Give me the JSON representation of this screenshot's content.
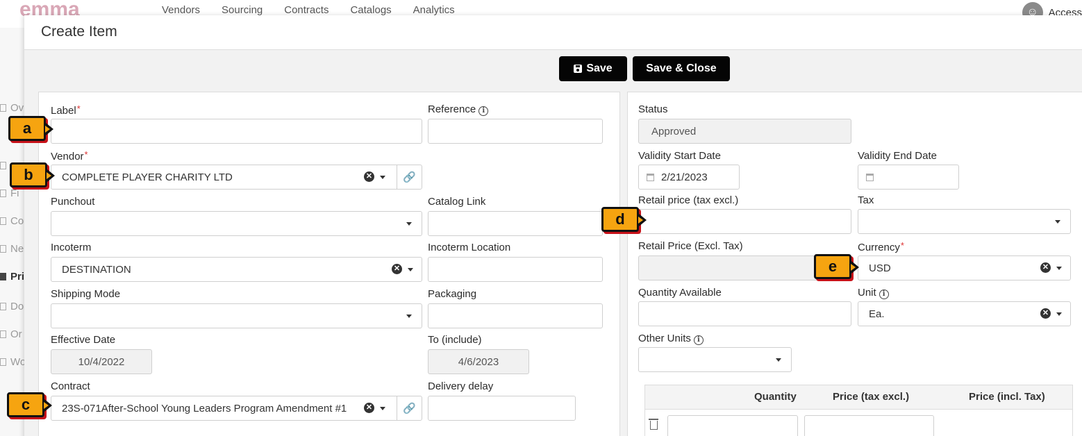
{
  "app": {
    "logo_text": "emma",
    "nav": [
      "Vendors",
      "Sourcing",
      "Contracts",
      "Catalogs",
      "Analytics"
    ],
    "access_label": "Access",
    "sidebar": [
      {
        "label": "Ov",
        "active": false
      },
      {
        "label": "",
        "active": false
      },
      {
        "label": "Fi",
        "active": false
      },
      {
        "label": "Co",
        "active": false
      },
      {
        "label": "Ne",
        "active": false
      },
      {
        "label": "Pri",
        "active": true
      },
      {
        "label": "Do",
        "active": false
      },
      {
        "label": "Or",
        "active": false
      },
      {
        "label": "Wo",
        "active": false
      }
    ]
  },
  "modal": {
    "title": "Create Item",
    "toolbar": {
      "save": "Save",
      "save_close": "Save & Close"
    }
  },
  "left": {
    "label": {
      "label": "Label",
      "value": ""
    },
    "reference": {
      "label": "Reference",
      "value": ""
    },
    "vendor": {
      "label": "Vendor",
      "value": "COMPLETE PLAYER CHARITY LTD"
    },
    "punchout": {
      "label": "Punchout",
      "value": ""
    },
    "catalog_link": {
      "label": "Catalog Link",
      "value": ""
    },
    "incoterm": {
      "label": "Incoterm",
      "value": "DESTINATION"
    },
    "incoterm_location": {
      "label": "Incoterm Location",
      "value": ""
    },
    "shipping_mode": {
      "label": "Shipping Mode",
      "value": ""
    },
    "packaging": {
      "label": "Packaging",
      "value": ""
    },
    "effective_date": {
      "label": "Effective Date",
      "value": "10/4/2022"
    },
    "to_include": {
      "label": "To (include)",
      "value": "4/6/2023"
    },
    "contract": {
      "label": "Contract",
      "value": "23S-071After-School Young Leaders Program Amendment #1"
    },
    "delivery_delay": {
      "label": "Delivery delay",
      "value": ""
    }
  },
  "right": {
    "status": {
      "label": "Status",
      "value": "Approved"
    },
    "validity_start": {
      "label": "Validity Start Date",
      "value": "2/21/2023"
    },
    "validity_end": {
      "label": "Validity End Date",
      "value": ""
    },
    "retail_price": {
      "label": "Retail price (tax excl.)",
      "value": ""
    },
    "tax": {
      "label": "Tax",
      "value": ""
    },
    "retail_price_excl": {
      "label": "Retail Price (Excl. Tax)",
      "value": ""
    },
    "currency": {
      "label": "Currency",
      "value": "USD"
    },
    "quantity_available": {
      "label": "Quantity Available",
      "value": ""
    },
    "unit": {
      "label": "Unit",
      "value": "Ea."
    },
    "other_units": {
      "label": "Other Units",
      "value": ""
    },
    "price_table": {
      "headers": [
        "Quantity",
        "Price (tax excl.)",
        "Price (incl. Tax)"
      ]
    }
  },
  "callouts": {
    "a": "a",
    "b": "b",
    "c": "c",
    "d": "d",
    "e": "e"
  },
  "colors": {
    "callout_fill": "#f6a410",
    "callout_shadow": "#c8121a",
    "button": "#050505",
    "link_icon": "#2a7bd6",
    "required": "#d33"
  }
}
